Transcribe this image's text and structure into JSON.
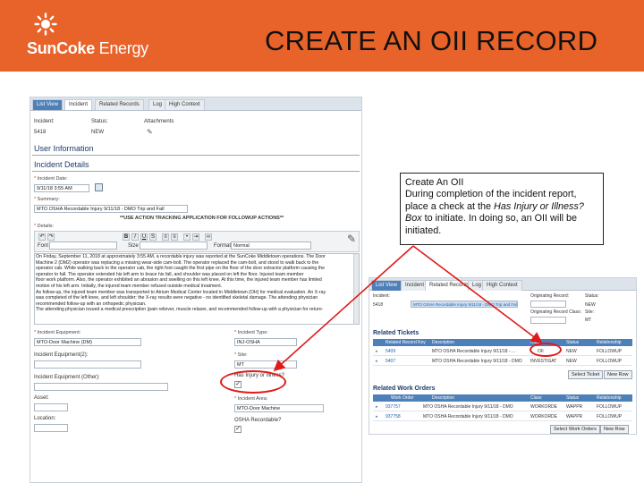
{
  "header": {
    "brand_sun": "Sun",
    "brand_coke": "Coke",
    "brand_energy": " Energy",
    "title": "CREATE AN OII RECORD"
  },
  "left_form": {
    "tabs": [
      "List View",
      "Incident",
      "Related Records",
      "Log",
      "High Context"
    ],
    "incident_label": "Incident:",
    "incident_value": "5418",
    "status_label": "Status:",
    "status_value": "NEW",
    "attachments_label": "Attachments",
    "user_information": "User Information",
    "incident_details": "Incident Details",
    "incident_date_label": "Incident Date:",
    "incident_date_value": "9/11/18 3:55 AM",
    "summary_label": "Summary:",
    "summary_value": "MTO OSHA Recordable Injury 9/11/18 - DMO Trip and Fall",
    "use_action_tracking": "**USE ACTION TRACKING APPLICATION FOR FOLLOWUP ACTIONS**",
    "details_label": "Details:",
    "font_label": "Font",
    "size_label": "Size",
    "format_label": "Format",
    "format_value": "Normal",
    "narrative": [
      "On Friday, September 11, 2018 at approximately 3:55 AM, a recordable injury was reported at the SunCoke Middletown operations. The Door",
      "Machine 2 (DM2) operator was replacing a missing wear-side cam-bolt. The operator replaced the cam-bolt, and stood to walk back to the",
      "operator cab. While walking back to the operator cab, the right foot caught the first pipe on the floor of the door extractor platform causing the",
      "operator to fall. The operator extended his left arm to brace his fall, and shoulder was placed on left the floor. Injured team member",
      "floor work platform. Also, the operator exhibited an abrasion and swelling on this left knee. At this time, the injured team member has limited",
      "motion of his left arm. Initially, the injured team member refused outside medical treatment.",
      "As follow-up, the injured team member was transported to Atrium Medical Center located in Middletown (OH) for medical evaluation. An X-ray",
      "was completed of the left knee, and left shoulder; the X-ray results were negative - no identified skeletal damage. The attending physician",
      "recommended follow-up with an orthopedic physician.",
      "The attending physician issued a medical prescription (pain reliever, muscle relaxer, and recommended follow-up with a physician for return-"
    ],
    "incident_equipment_label": "Incident Equipment:",
    "incident_equipment_value": "MTO-Door Machine (DM)",
    "incident_equipment2_label": "Incident Equipment(2):",
    "incident_equipment_other_label": "Incident Equipment (Other):",
    "asset_label": "Asset:",
    "location_label": "Location:",
    "incident_type_label": "Incident Type:",
    "incident_type_value": "INJ-OSHA",
    "site_label": "Site:",
    "site_value": "MT",
    "has_injury_label": "Has Injury or Illness?",
    "incident_area_label": "Incident Area:",
    "incident_area_value": "MTO-Door Machine",
    "osha_recordable_label": "OSHA Recordable?"
  },
  "callout": {
    "line1": "Create An OII",
    "line2a": "During completion of the incident report, place a check at the ",
    "line2b": "Has Injury or Illness? Box",
    "line2c": " to initiate. In doing so, an OII will be initiated."
  },
  "right_form": {
    "tabs": [
      "List View",
      "Incident",
      "Related Records",
      "Log",
      "High Context"
    ],
    "incident_label": "Incident:",
    "incident_value": "5418",
    "incident_summary": "MTO OSHA Recordable Injury 9/11/18 - DMO Trip and Fall",
    "originating_record_label": "Originating Record:",
    "originating_class_label": "Originating Record Class:",
    "status_label": "Status:",
    "status_value": "NEW",
    "site_label": "Site:",
    "site_value": "MT",
    "related_tickets_title": "Related Tickets",
    "tickets_headers": [
      "Related Record Key",
      "Description",
      "Class",
      "Status",
      "Relationship"
    ],
    "tickets": [
      {
        "key": "5409",
        "desc": "MTO OSHA Recordable Injury 9/11/18 - ...",
        "cls": "OII",
        "status": "NEW",
        "rel": "FOLLOWUP"
      },
      {
        "key": "5407",
        "desc": "MTO OSHA Recordable Injury 9/11/18 - DMO",
        "cls": "INVESTIGAT",
        "status": "NEW",
        "rel": "FOLLOWUP"
      }
    ],
    "select_ticket": "Select Ticket",
    "new_row": "New Row",
    "related_work_orders_title": "Related Work Orders",
    "wo_headers": [
      "Work Order",
      "Description",
      "Class",
      "Status",
      "Relationship"
    ],
    "work_orders": [
      {
        "wo": "937757",
        "desc": "MTO OSHA Recordable Injury 9/11/18 - DMO",
        "cls": "WORKORDE",
        "status": "WAPPR",
        "rel": "FOLLOWUP"
      },
      {
        "wo": "937758",
        "desc": "MTO OSHA Recordable Injury 9/11/18 - DMO",
        "cls": "WORKORDE",
        "status": "WAPPR",
        "rel": "FOLLOWUP"
      }
    ],
    "select_work_orders": "Select Work Orders",
    "new_row_2": "New Row"
  },
  "colors": {
    "header_orange": "#e8632a",
    "annotation_red": "#e01a1a",
    "table_blue": "#4d7fb8"
  }
}
